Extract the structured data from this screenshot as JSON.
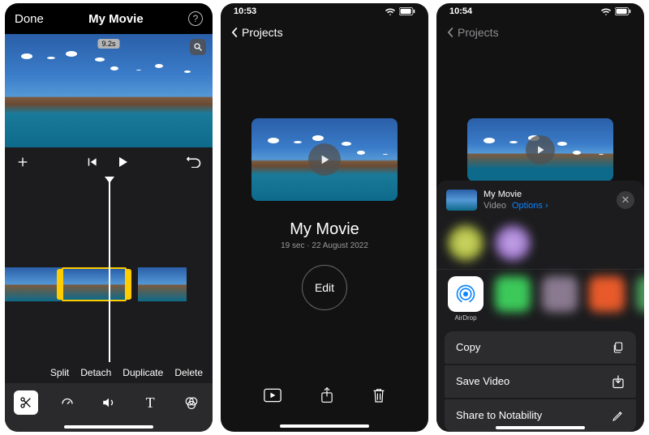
{
  "phone1": {
    "done": "Done",
    "title": "My Movie",
    "duration_badge": "9.2s",
    "edit_actions": {
      "split": "Split",
      "detach": "Detach",
      "duplicate": "Duplicate",
      "delete": "Delete"
    }
  },
  "phone2": {
    "time": "10:53",
    "back": "Projects",
    "movie_title": "My Movie",
    "movie_sub": "19 sec · 22 August 2022",
    "edit": "Edit"
  },
  "phone3": {
    "time": "10:54",
    "back": "Projects",
    "share_title": "My Movie",
    "share_kind": "Video",
    "options": "Options",
    "airdrop": "AirDrop",
    "actions": {
      "copy": "Copy",
      "save_video": "Save Video",
      "share_notability": "Share to Notability"
    }
  }
}
